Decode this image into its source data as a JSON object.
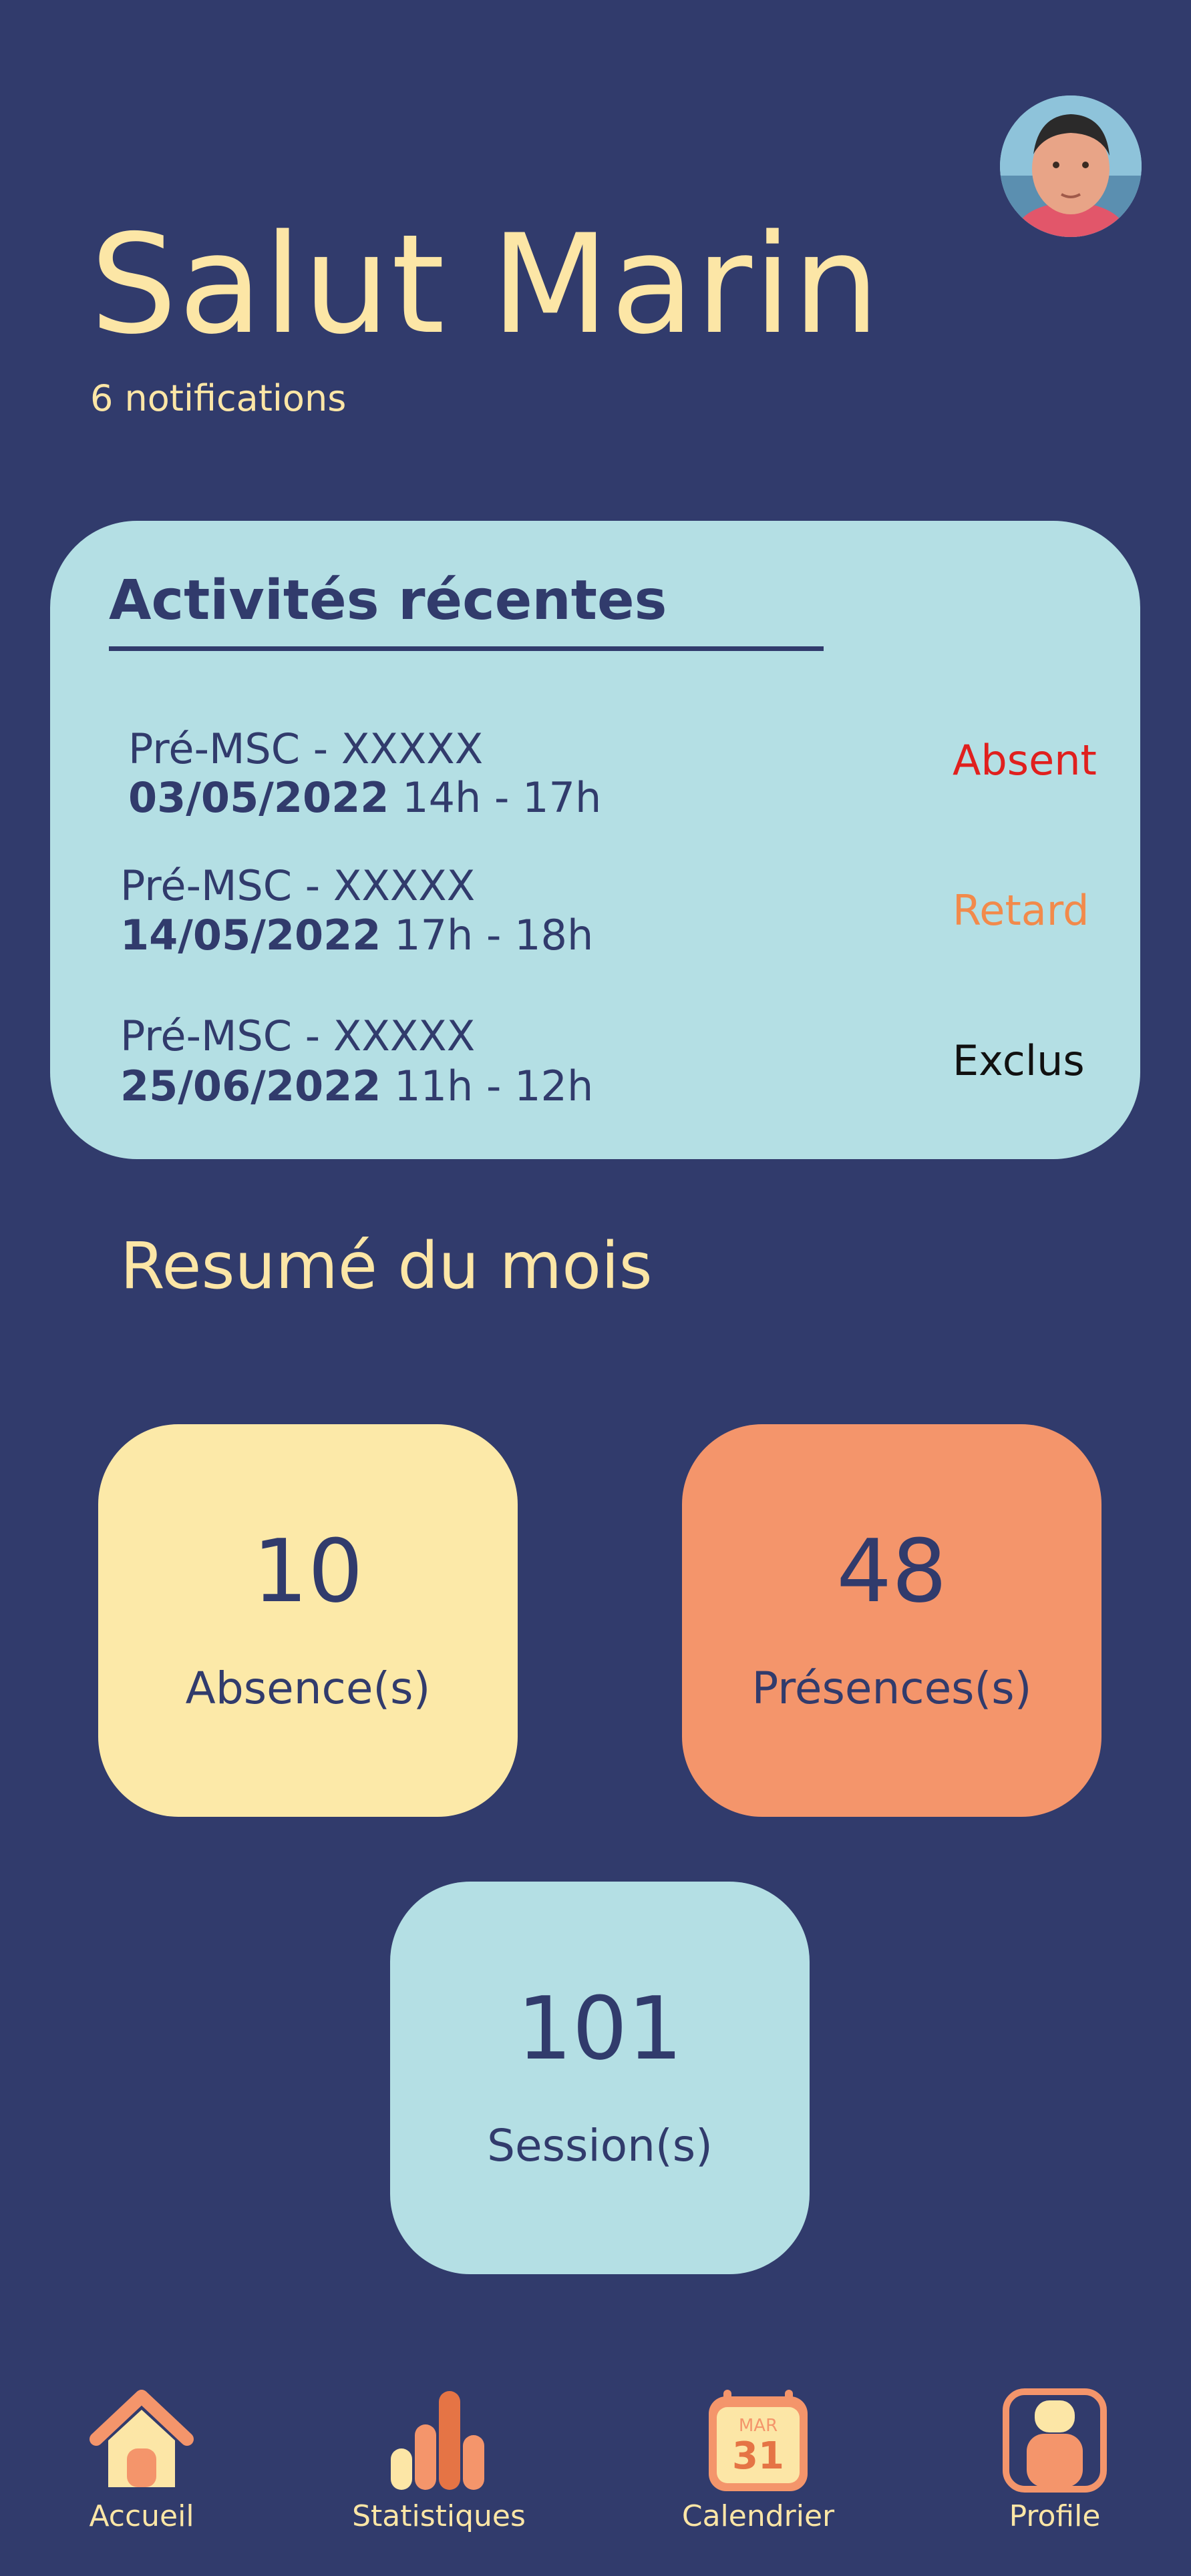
{
  "header": {
    "greeting": "Salut Marin",
    "notifications": "6 notifications"
  },
  "recent": {
    "title": "Activités récentes",
    "items": [
      {
        "name": "Pré-MSC - XXXXX",
        "date": "03/05/2022",
        "time": "14h - 17h",
        "status": "Absent",
        "status_color": "#E0201E"
      },
      {
        "name": "Pré-MSC - XXXXX",
        "date": "14/05/2022",
        "time": "17h - 18h",
        "status": "Retard",
        "status_color": "#F28A4B"
      },
      {
        "name": "Pré-MSC - XXXXX",
        "date": "25/06/2022",
        "time": "11h - 12h",
        "status": "Exclus",
        "status_color": "#111111"
      }
    ]
  },
  "summary": {
    "title": "Resumé du mois",
    "absences": {
      "value": "10",
      "label": "Absence(s)"
    },
    "presences": {
      "value": "48",
      "label": "Présences(s)"
    },
    "sessions": {
      "value": "101",
      "label": "Session(s)"
    }
  },
  "nav": {
    "items": [
      {
        "label": "Accueil",
        "icon": "home-icon"
      },
      {
        "label": "Statistiques",
        "icon": "bar-chart-icon"
      },
      {
        "label": "Calendrier",
        "icon": "calendar-icon",
        "calendar_month": "MAR",
        "calendar_day": "31"
      },
      {
        "label": "Profile",
        "icon": "profile-icon"
      }
    ]
  },
  "colors": {
    "background": "#313B6C",
    "accent_yellow": "#FCE6A6",
    "accent_orange": "#F4956B",
    "card_teal": "#B4DFE4"
  }
}
